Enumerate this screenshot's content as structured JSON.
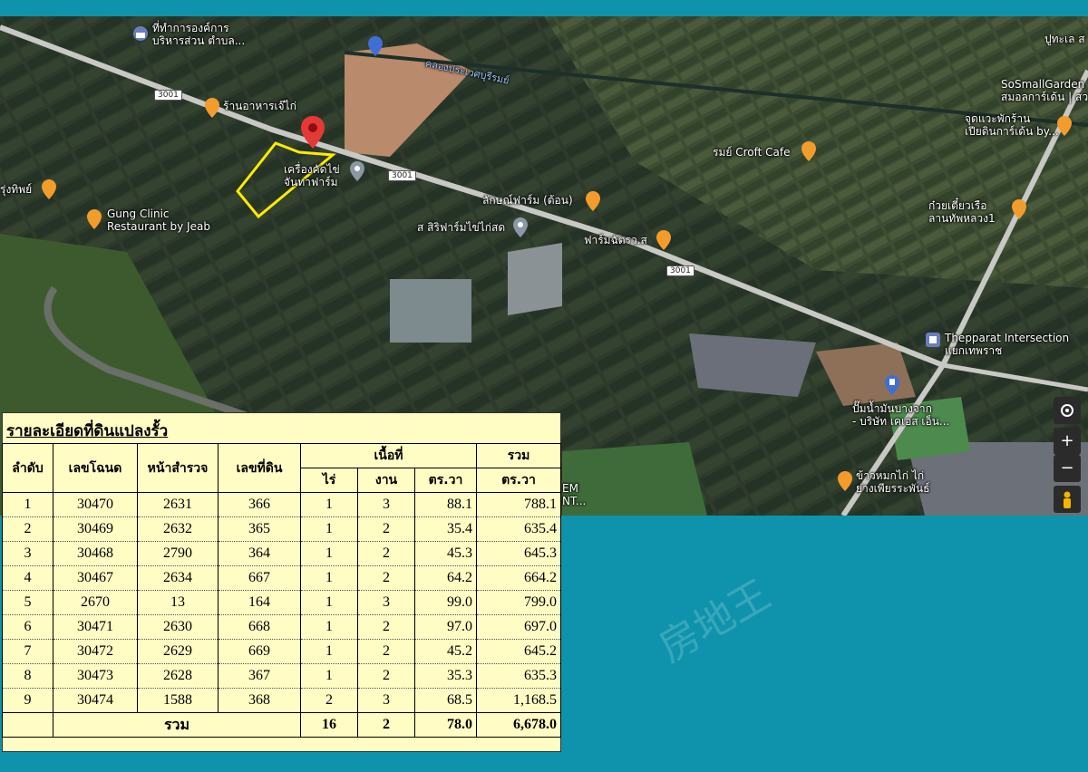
{
  "map": {
    "roads": [
      {
        "id": "r1",
        "label": "3001"
      },
      {
        "id": "r2",
        "label": "3001"
      },
      {
        "id": "r3",
        "label": "3001"
      }
    ],
    "canal_label": "คลองประเวศบุรีรมย์",
    "places": [
      {
        "id": "p1",
        "text": "ที่ทำการองค์การ\nบริหารส่วน ตำบล...",
        "icon": "government-icon"
      },
      {
        "id": "p2",
        "text": "ร้านอาหารเจ๊ไก่",
        "icon": "restaurant-icon"
      },
      {
        "id": "p3",
        "text": "เครื่องคัดไข่\nจันทาฟาร์ม",
        "icon": "place-icon"
      },
      {
        "id": "p4",
        "text": "รุ่งทิพย์",
        "icon": "restaurant-icon"
      },
      {
        "id": "p5",
        "text": "Gung Clinic\nRestaurant by Jeab",
        "icon": "restaurant-icon"
      },
      {
        "id": "p6",
        "text": "ลักษณ์ฟาร์ม (ต้อน)",
        "icon": "bar-icon"
      },
      {
        "id": "p7",
        "text": "ส สิริฟาร์มไข่ไก่สด",
        "icon": "place-icon"
      },
      {
        "id": "p8",
        "text": "ฟาร์มฉัตรว.ส",
        "icon": "bar-icon"
      },
      {
        "id": "p9",
        "text": "รมย์ Croft Cafe",
        "icon": "cafe-icon"
      },
      {
        "id": "p10",
        "text": "SoSmallGarden\nสมอลการ์เด้น | สว",
        "icon": "place-icon"
      },
      {
        "id": "p11",
        "text": "จุดแวะพักร้าน\nเปียดินการ์เด้น by...",
        "icon": "restaurant-icon"
      },
      {
        "id": "p12",
        "text": "ก๋วยเตี๋ยวเรือ\nลานทัพหลวง1",
        "icon": "restaurant-icon"
      },
      {
        "id": "p13",
        "text": "Thepparat Intersection\nแยกเทพราช",
        "icon": "intersection-icon"
      },
      {
        "id": "p14",
        "text": "ปั๊มน้ำมันบางจาก\n- บริษัท เคเอส เอ็น...",
        "icon": "fuel-icon"
      },
      {
        "id": "p15",
        "text": "ข้าวหมกไก่ ไก่\nย่างเพียรระพันธ์",
        "icon": "restaurant-icon"
      },
      {
        "id": "p16",
        "text": "EM\nNT...",
        "icon": ""
      },
      {
        "id": "p17",
        "text": "ปูทะเล ส",
        "icon": ""
      }
    ],
    "controls": {
      "locate": "my-location-icon",
      "zoom_in": "+",
      "zoom_out": "−",
      "pegman": "pegman-icon"
    }
  },
  "watermark": "房地王",
  "table": {
    "title": "รายละเอียดที่ดินแปลงรั้ว",
    "headers": {
      "no": "ลำดับ",
      "deed": "เลขโฉนด",
      "survey": "หน้าสำรวจ",
      "land": "เลขที่ดิน",
      "area": "เนื้อที่",
      "rai": "ไร่",
      "ngan": "งาน",
      "wa": "ตร.วา",
      "total1": "รวม",
      "total2": "ตร.วา"
    },
    "rows": [
      {
        "no": "1",
        "deed": "30470",
        "survey": "2631",
        "land": "366",
        "rai": "1",
        "ngan": "3",
        "wa": "88.1",
        "total": "788.1"
      },
      {
        "no": "2",
        "deed": "30469",
        "survey": "2632",
        "land": "365",
        "rai": "1",
        "ngan": "2",
        "wa": "35.4",
        "total": "635.4"
      },
      {
        "no": "3",
        "deed": "30468",
        "survey": "2790",
        "land": "364",
        "rai": "1",
        "ngan": "2",
        "wa": "45.3",
        "total": "645.3"
      },
      {
        "no": "4",
        "deed": "30467",
        "survey": "2634",
        "land": "667",
        "rai": "1",
        "ngan": "2",
        "wa": "64.2",
        "total": "664.2"
      },
      {
        "no": "5",
        "deed": "2670",
        "survey": "13",
        "land": "164",
        "rai": "1",
        "ngan": "3",
        "wa": "99.0",
        "total": "799.0"
      },
      {
        "no": "6",
        "deed": "30471",
        "survey": "2630",
        "land": "668",
        "rai": "1",
        "ngan": "2",
        "wa": "97.0",
        "total": "697.0"
      },
      {
        "no": "7",
        "deed": "30472",
        "survey": "2629",
        "land": "669",
        "rai": "1",
        "ngan": "2",
        "wa": "45.2",
        "total": "645.2"
      },
      {
        "no": "8",
        "deed": "30473",
        "survey": "2628",
        "land": "367",
        "rai": "1",
        "ngan": "2",
        "wa": "35.3",
        "total": "635.3"
      },
      {
        "no": "9",
        "deed": "30474",
        "survey": "1588",
        "land": "368",
        "rai": "2",
        "ngan": "3",
        "wa": "68.5",
        "total": "1,168.5"
      }
    ],
    "sum": {
      "label": "รวม",
      "rai": "16",
      "ngan": "2",
      "wa": "78.0",
      "total": "6,678.0"
    }
  }
}
